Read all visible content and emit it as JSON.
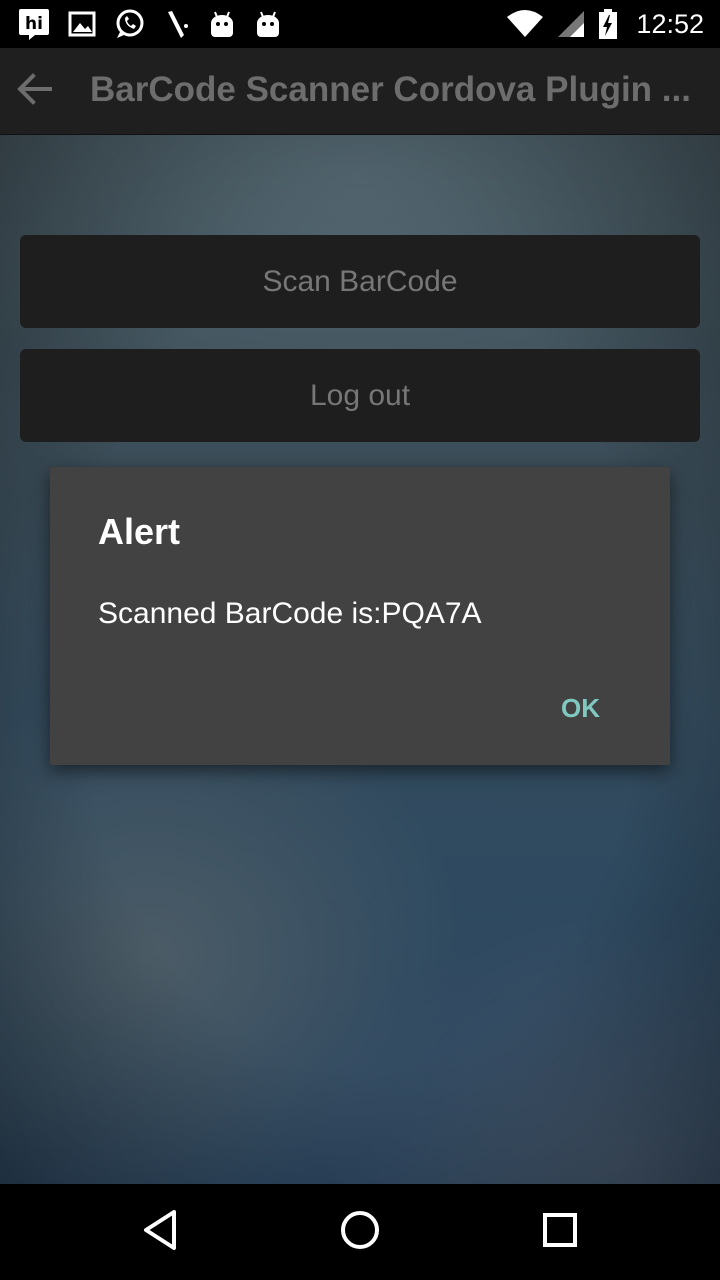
{
  "status_bar": {
    "time": "12:52",
    "notification_icons": [
      "hi-app-icon",
      "gallery-icon",
      "whatsapp-icon",
      "pen-icon",
      "android-icon",
      "android-icon"
    ],
    "system_icons": [
      "wifi-icon",
      "cell-signal-icon",
      "battery-charging-icon"
    ]
  },
  "toolbar": {
    "title": "BarCode Scanner Cordova Plugin ...",
    "back_icon": "arrow-back-icon",
    "background": "#1f1f1f",
    "title_color": "#6d6d6d"
  },
  "main": {
    "scan_button_label": "Scan BarCode",
    "logout_button_label": "Log out",
    "button_color": "#1e1e1e"
  },
  "dialog": {
    "title": "Alert",
    "message": "Scanned BarCode is:PQA7A",
    "ok_label": "OK",
    "background": "#424242",
    "accent": "#7fc9c0"
  },
  "nav_bar": {
    "icons": [
      "nav-back-icon",
      "nav-home-icon",
      "nav-recents-icon"
    ]
  }
}
